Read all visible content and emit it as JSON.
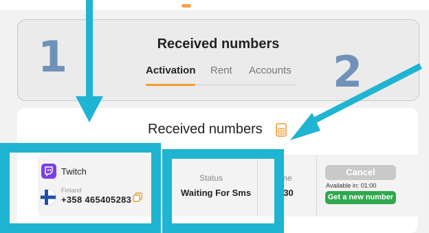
{
  "header": {
    "title": "Received numbers",
    "tabs": [
      {
        "label": "Activation",
        "active": true
      },
      {
        "label": "Rent",
        "active": false
      },
      {
        "label": "Accounts",
        "active": false
      }
    ]
  },
  "annotations": {
    "label_1": "1",
    "label_2": "2",
    "highlight_color": "#1fb4d2"
  },
  "list": {
    "title": "Received numbers",
    "export_icon": "document-export-icon",
    "rows": [
      {
        "service": "Twitch",
        "service_icon": "twitch-icon",
        "country": "Finland",
        "country_flag": "finland-flag-icon",
        "phone": "+358 465405283",
        "copy_icon": "copy-icon",
        "status_label": "Status",
        "status_value": "Waiting For Sms",
        "time_label": "me",
        "time_value": ":30",
        "cancel_label": "Cancel",
        "available_text": "Available in: 01:00",
        "get_new_label": "Get a new number"
      }
    ]
  },
  "colors": {
    "accent_orange": "#f39a2b",
    "button_green": "#2fa84f",
    "button_disabled": "#c9c9c9",
    "twitch_purple": "#7b3fe4"
  }
}
